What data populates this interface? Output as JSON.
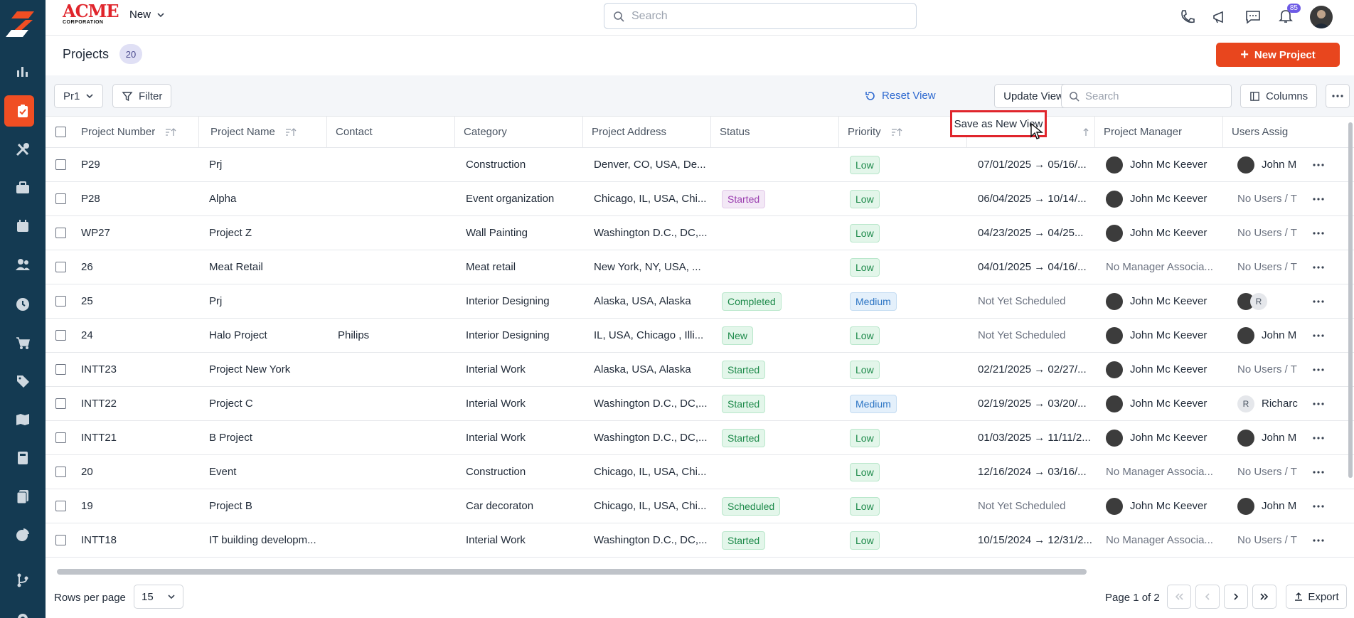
{
  "header": {
    "brand": "ACME",
    "brand_sub": "CORPORATION",
    "new_menu_label": "New",
    "search_placeholder": "Search",
    "notification_count": "85"
  },
  "page": {
    "title": "Projects",
    "count": "20",
    "new_project_label": "New Project"
  },
  "toolbar": {
    "view_select": "Pr1",
    "filter_label": "Filter",
    "reset_view_label": "Reset View",
    "update_view_label": "Update View",
    "search_placeholder": "Search",
    "columns_label": "Columns"
  },
  "popup": {
    "save_as_new_view_label": "Save as New View"
  },
  "table": {
    "columns": [
      "Project Number",
      "Project Name",
      "Contact",
      "Category",
      "Project Address",
      "Status",
      "Priority",
      "",
      "Project Manager",
      "Users Assig"
    ],
    "rows": [
      {
        "number": "P29",
        "name": "Prj",
        "contact": "",
        "category": "Construction",
        "address": "Denver, CO, USA, De...",
        "status": "",
        "status_color": "",
        "priority": "Low",
        "priority_color": "green",
        "dates": "07/01/2025 → 05/16/...",
        "dates_muted": false,
        "manager": "John Mc Keever",
        "manager_avatar": true,
        "users": "John M",
        "users_type": "avatar"
      },
      {
        "number": "P28",
        "name": "Alpha",
        "contact": "",
        "category": "Event organization",
        "address": "Chicago, IL, USA, Chi...",
        "status": "Started",
        "status_color": "purple",
        "priority": "Low",
        "priority_color": "green",
        "dates": "06/04/2025 → 10/14/...",
        "dates_muted": false,
        "manager": "John Mc Keever",
        "manager_avatar": true,
        "users": "No Users / T",
        "users_type": "muted"
      },
      {
        "number": "WP27",
        "name": "Project Z",
        "contact": "",
        "category": "Wall Painting",
        "address": "Washington D.C., DC,...",
        "status": "",
        "status_color": "",
        "priority": "Low",
        "priority_color": "green",
        "dates": "04/23/2025 → 04/25...",
        "dates_muted": false,
        "manager": "John Mc Keever",
        "manager_avatar": true,
        "users": "No Users / T",
        "users_type": "muted"
      },
      {
        "number": "26",
        "name": "Meat Retail",
        "contact": "",
        "category": "Meat retail",
        "address": "New York, NY, USA, ...",
        "status": "",
        "status_color": "",
        "priority": "Low",
        "priority_color": "green",
        "dates": "04/01/2025 → 04/16/...",
        "dates_muted": false,
        "manager": "No Manager Associa...",
        "manager_avatar": false,
        "users": "No Users / T",
        "users_type": "muted"
      },
      {
        "number": "25",
        "name": "Prj",
        "contact": "",
        "category": "Interior Designing",
        "address": "Alaska, USA, Alaska",
        "status": "Completed",
        "status_color": "green",
        "priority": "Medium",
        "priority_color": "blue",
        "dates": "Not Yet Scheduled",
        "dates_muted": true,
        "manager": "John Mc Keever",
        "manager_avatar": true,
        "users": "R",
        "users_type": "avatar-r"
      },
      {
        "number": "24",
        "name": "Halo Project",
        "contact": "Philips",
        "category": "Interior Designing",
        "address": "IL, USA, Chicago , Illi...",
        "status": "New",
        "status_color": "green",
        "priority": "Low",
        "priority_color": "green",
        "dates": "Not Yet Scheduled",
        "dates_muted": true,
        "manager": "John Mc Keever",
        "manager_avatar": true,
        "users": "John M",
        "users_type": "avatar"
      },
      {
        "number": "INTT23",
        "name": "Project New York",
        "contact": "",
        "category": "Interial Work",
        "address": "Alaska, USA, Alaska",
        "status": "Started",
        "status_color": "green",
        "priority": "Low",
        "priority_color": "green",
        "dates": "02/21/2025 → 02/27/...",
        "dates_muted": false,
        "manager": "John Mc Keever",
        "manager_avatar": true,
        "users": "No Users / T",
        "users_type": "muted"
      },
      {
        "number": "INTT22",
        "name": "Project C",
        "contact": "",
        "category": "Interial Work",
        "address": "Washington D.C., DC,...",
        "status": "Started",
        "status_color": "green",
        "priority": "Medium",
        "priority_color": "blue",
        "dates": "02/19/2025 → 03/20/...",
        "dates_muted": false,
        "manager": "John Mc Keever",
        "manager_avatar": true,
        "users": "Richarc",
        "users_type": "r-initial"
      },
      {
        "number": "INTT21",
        "name": "B Project",
        "contact": "",
        "category": "Interial Work",
        "address": "Washington D.C., DC,...",
        "status": "Started",
        "status_color": "green",
        "priority": "Low",
        "priority_color": "green",
        "dates": "01/03/2025 → 11/11/2...",
        "dates_muted": false,
        "manager": "John Mc Keever",
        "manager_avatar": true,
        "users": "John M",
        "users_type": "avatar"
      },
      {
        "number": "20",
        "name": "Event",
        "contact": "",
        "category": "Construction",
        "address": "Chicago, IL, USA, Chi...",
        "status": "",
        "status_color": "",
        "priority": "Low",
        "priority_color": "green",
        "dates": "12/16/2024 → 03/16/...",
        "dates_muted": false,
        "manager": "No Manager Associa...",
        "manager_avatar": false,
        "users": "No Users / T",
        "users_type": "muted"
      },
      {
        "number": "19",
        "name": "Project B",
        "contact": "",
        "category": "Car decoraton",
        "address": "Chicago, IL, USA, Chi...",
        "status": "Scheduled",
        "status_color": "green",
        "priority": "Low",
        "priority_color": "green",
        "dates": "Not Yet Scheduled",
        "dates_muted": true,
        "manager": "John Mc Keever",
        "manager_avatar": true,
        "users": "John M",
        "users_type": "avatar"
      },
      {
        "number": "INTT18",
        "name": "IT building developm...",
        "contact": "",
        "category": "Interial Work",
        "address": "Washington D.C., DC,...",
        "status": "Started",
        "status_color": "green",
        "priority": "Low",
        "priority_color": "green",
        "dates": "10/15/2024 → 12/31/2...",
        "dates_muted": false,
        "manager": "No Manager Associa...",
        "manager_avatar": false,
        "users": "No Users / T",
        "users_type": "muted"
      }
    ]
  },
  "footer": {
    "rows_per_page_label": "Rows per page",
    "rows_per_page_value": "15",
    "page_info": "Page 1 of 2",
    "export_label": "Export"
  },
  "colors": {
    "sidebar_bg": "#143a52",
    "accent": "#e8461e"
  },
  "sidebar_icons": [
    "bar-chart-icon",
    "clipboard-icon",
    "tools-icon",
    "briefcase-icon",
    "calendar-icon",
    "users-icon",
    "clock-icon",
    "cart-icon",
    "tag-icon",
    "map-icon",
    "calculator-icon",
    "documents-icon",
    "pie-chart-icon",
    "branch-icon",
    "settings-icon"
  ]
}
